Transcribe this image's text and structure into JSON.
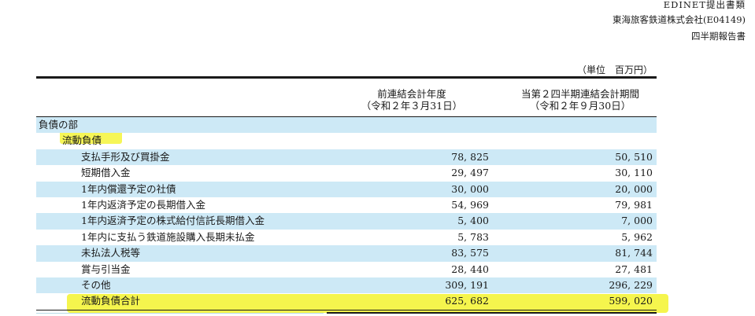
{
  "header": {
    "source": "EDINET提出書類",
    "company": "東海旅客鉄道株式会社(E04149)",
    "doc_type": "四半期報告書"
  },
  "unit": {
    "label": "（単位",
    "value": "百万円）"
  },
  "columns": [
    {
      "line1": "前連結会計年度",
      "line2": "（令和２年３月31日）"
    },
    {
      "line1": "当第２四半期連結会計期間",
      "line2": "（令和２年９月30日）"
    }
  ],
  "rows": [
    {
      "label": "負債の部",
      "prev": "",
      "curr": ""
    },
    {
      "label": "流動負債",
      "prev": "",
      "curr": ""
    },
    {
      "label": "支払手形及び買掛金",
      "prev": "78, 825",
      "curr": "50, 510"
    },
    {
      "label": "短期借入金",
      "prev": "29, 497",
      "curr": "30, 110"
    },
    {
      "label": "1年内償還予定の社債",
      "prev": "30, 000",
      "curr": "20, 000"
    },
    {
      "label": "1年内返済予定の長期借入金",
      "prev": "54, 969",
      "curr": "79, 981"
    },
    {
      "label": "1年内返済予定の株式給付信託長期借入金",
      "prev": "5, 400",
      "curr": "7, 000"
    },
    {
      "label": "1年内に支払う鉄道施設購入長期未払金",
      "prev": "5, 783",
      "curr": "5, 962"
    },
    {
      "label": "未払法人税等",
      "prev": "83, 575",
      "curr": "81, 744"
    },
    {
      "label": "賞与引当金",
      "prev": "28, 440",
      "curr": "27, 481"
    },
    {
      "label": "その他",
      "prev": "309, 191",
      "curr": "296, 229"
    },
    {
      "label": "流動負債合計",
      "prev": "625, 682",
      "curr": "599, 020"
    }
  ],
  "highlight_color": "#f4f43a",
  "row_tint_color": "#cde9f6"
}
